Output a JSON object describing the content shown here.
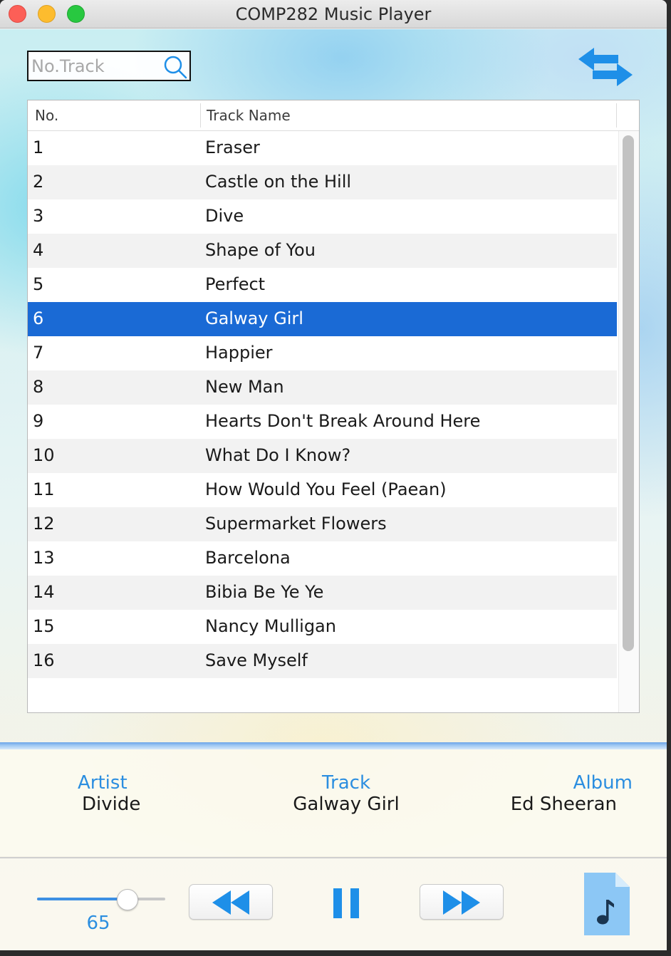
{
  "window": {
    "title": "COMP282 Music Player"
  },
  "search": {
    "placeholder": "No.Track",
    "value": ""
  },
  "table": {
    "headers": {
      "no": "No.",
      "name": "Track Name"
    },
    "selected_index": 5,
    "rows": [
      {
        "no": "1",
        "name": "Eraser"
      },
      {
        "no": "2",
        "name": "Castle on the Hill"
      },
      {
        "no": "3",
        "name": "Dive"
      },
      {
        "no": "4",
        "name": "Shape of You"
      },
      {
        "no": "5",
        "name": "Perfect"
      },
      {
        "no": "6",
        "name": "Galway Girl"
      },
      {
        "no": "7",
        "name": "Happier"
      },
      {
        "no": "8",
        "name": "New Man"
      },
      {
        "no": "9",
        "name": "Hearts Don't Break Around Here"
      },
      {
        "no": "10",
        "name": "What Do I Know?"
      },
      {
        "no": "11",
        "name": "How Would You Feel (Paean)"
      },
      {
        "no": "12",
        "name": "Supermarket Flowers"
      },
      {
        "no": "13",
        "name": "Barcelona"
      },
      {
        "no": "14",
        "name": "Bibia Be Ye Ye"
      },
      {
        "no": "15",
        "name": "Nancy Mulligan"
      },
      {
        "no": "16",
        "name": "Save Myself"
      }
    ]
  },
  "info": {
    "artist_label": "Artist",
    "artist_value": "Divide",
    "track_label": "Track",
    "track_value": "Galway Girl",
    "album_label": "Album",
    "album_value": "Ed Sheeran"
  },
  "controls": {
    "volume": 65,
    "volume_label": "65",
    "icons": [
      "rewind-icon",
      "pause-icon",
      "fast-forward-icon",
      "music-file-icon",
      "swap-arrows-icon",
      "search-icon"
    ]
  },
  "colors": {
    "accent": "#2b8ee0",
    "selection": "#1a6ad5",
    "icon_blue": "#1e8fe8"
  }
}
